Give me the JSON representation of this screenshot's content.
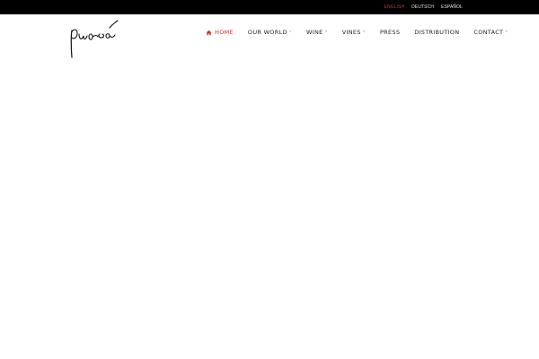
{
  "languages": [
    {
      "label": "ENGLISH",
      "active": true
    },
    {
      "label": "DEUTSCH",
      "active": false
    },
    {
      "label": "ESPAÑOL",
      "active": false
    }
  ],
  "nav": {
    "home": "HOME",
    "our_world": "OUR WORLD",
    "wine": "WINE",
    "vines": "VINES",
    "press": "PRESS",
    "distribution": "DISTRIBUTION",
    "contact": "CONTACT"
  },
  "icons": {
    "home": "home-icon",
    "submenu": "chevron-down-icon",
    "logo": "signature-logo"
  },
  "colors": {
    "topbar": "#000000",
    "accent": "#b83a2a",
    "nav_text": "#222222"
  }
}
